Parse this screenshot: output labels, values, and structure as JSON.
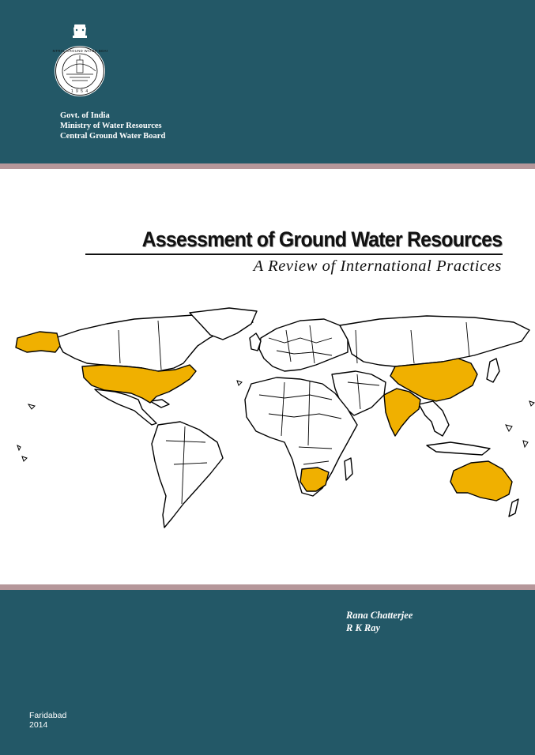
{
  "colors": {
    "band": "#235867",
    "stripe": "#b5979a",
    "highlight": "#f0b000",
    "land": "#ffffff",
    "border": "#000000"
  },
  "header": {
    "organization": [
      "Govt. of India",
      "Ministry of Water Resources",
      "Central Ground Water Board"
    ],
    "emblem_icon": "national-emblem-icon",
    "seal_icon": "cgwb-seal-icon"
  },
  "title": {
    "main": "Assessment of Ground Water Resources",
    "subtitle": "A Review of International Practices"
  },
  "map": {
    "icon": "world-map-icon",
    "highlighted_regions": [
      "USA",
      "Alaska",
      "China",
      "India",
      "South Africa",
      "Australia"
    ]
  },
  "authors": [
    "Rana Chatterjee",
    "R K Ray"
  ],
  "imprint": {
    "place": "Faridabad",
    "year": "2014"
  }
}
